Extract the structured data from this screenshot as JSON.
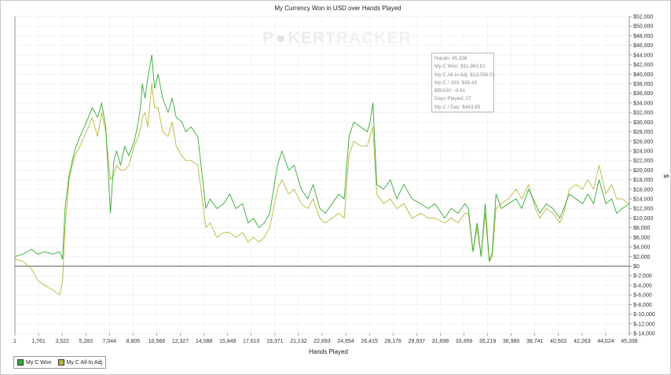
{
  "chart_data": {
    "type": "line",
    "title": "My Currency Won in USD over Hands Played",
    "xlabel": "Hands Played",
    "ylabel": "$",
    "watermark": {
      "part1": "P",
      "part2": "KER",
      "part3": "TRACKER"
    },
    "x_ticks": [
      "1",
      "1,761",
      "3,522",
      "5,283",
      "7,044",
      "8,805",
      "10,566",
      "12,327",
      "14,088",
      "15,849",
      "17,610",
      "19,371",
      "21,132",
      "22,893",
      "24,654",
      "26,415",
      "28,176",
      "29,937",
      "31,698",
      "33,459",
      "35,219",
      "36,980",
      "38,741",
      "40,502",
      "42,263",
      "44,024",
      "45,336"
    ],
    "xlim": [
      1,
      45336
    ],
    "ylim": [
      -14000,
      52000
    ],
    "y_ticks": [
      "$-14,000",
      "$-12,000",
      "$-10,000",
      "$-8,000",
      "$-6,000",
      "$-4,000",
      "$-2,000",
      "$0",
      "$2,000",
      "$4,000",
      "$6,000",
      "$8,000",
      "$10,000",
      "$12,000",
      "$14,000",
      "$16,000",
      "$18,000",
      "$20,000",
      "$22,000",
      "$24,000",
      "$26,000",
      "$28,000",
      "$30,000",
      "$32,000",
      "$34,000",
      "$36,000",
      "$38,000",
      "$40,000",
      "$42,000",
      "$44,000",
      "$46,000",
      "$48,000",
      "$50,000",
      "$52,000"
    ],
    "y_tick_values": [
      -14000,
      -12000,
      -10000,
      -8000,
      -6000,
      -4000,
      -2000,
      0,
      2000,
      4000,
      6000,
      8000,
      10000,
      12000,
      14000,
      16000,
      18000,
      20000,
      22000,
      24000,
      26000,
      28000,
      30000,
      32000,
      34000,
      36000,
      38000,
      40000,
      42000,
      44000,
      46000,
      48000,
      50000,
      52000
    ],
    "grid": true,
    "legend_position": "bottom-left",
    "series": [
      {
        "name": "My C Won",
        "color": "#33aa33",
        "x": [
          1,
          600,
          1200,
          1700,
          2200,
          2800,
          3300,
          3522,
          3700,
          4000,
          4400,
          4800,
          5283,
          5700,
          6100,
          6400,
          6700,
          7044,
          7300,
          7500,
          7800,
          8100,
          8400,
          8805,
          9100,
          9300,
          9400,
          9600,
          9800,
          10100,
          10300,
          10566,
          10900,
          11300,
          11600,
          11900,
          12327,
          12600,
          13000,
          13500,
          14088,
          14400,
          14900,
          15400,
          15849,
          16300,
          16800,
          17200,
          17610,
          18000,
          18400,
          18800,
          19371,
          19700,
          20200,
          20600,
          21132,
          21600,
          22000,
          22500,
          22893,
          23400,
          23900,
          24300,
          24654,
          25000,
          25500,
          26000,
          26200,
          26415,
          26700,
          27200,
          27700,
          28176,
          28700,
          29300,
          29937,
          30500,
          31000,
          31698,
          32200,
          32700,
          33200,
          33459,
          33800,
          34100,
          34400,
          34700,
          35000,
          35219,
          35500,
          35900,
          36400,
          36980,
          37400,
          37900,
          38400,
          38741,
          39200,
          39700,
          40200,
          40502,
          40900,
          41400,
          41900,
          42263,
          42700,
          43100,
          43600,
          44024,
          44400,
          44800,
          45336
        ],
        "y": [
          2000,
          2500,
          3500,
          2500,
          3000,
          2500,
          3000,
          1500,
          12000,
          19000,
          24000,
          27000,
          30000,
          33000,
          31000,
          34000,
          29000,
          11000,
          22000,
          24000,
          21000,
          25000,
          23000,
          26000,
          30000,
          34000,
          38000,
          35000,
          39000,
          44000,
          37000,
          40000,
          35000,
          32000,
          35000,
          31000,
          30000,
          28000,
          29000,
          27000,
          12000,
          14000,
          12000,
          13000,
          15000,
          12000,
          13000,
          9000,
          10000,
          8000,
          9000,
          11000,
          21000,
          24000,
          20000,
          21000,
          16000,
          14000,
          17000,
          12000,
          11000,
          13000,
          15000,
          14000,
          27000,
          30000,
          29000,
          28000,
          30000,
          34000,
          17000,
          16000,
          18000,
          14000,
          17000,
          14000,
          13000,
          12000,
          13000,
          10000,
          12000,
          11000,
          13000,
          12000,
          3000,
          9000,
          2000,
          13000,
          1000,
          3000,
          15000,
          12000,
          13000,
          14000,
          12000,
          16000,
          13000,
          11000,
          13000,
          12000,
          10000,
          12000,
          15000,
          14000,
          13000,
          15000,
          13000,
          18000,
          13000,
          14000,
          11000,
          12000,
          13000
        ]
      },
      {
        "name": "My C All-In Adj",
        "color": "#b8b83a",
        "x": [
          1,
          600,
          1200,
          1700,
          2200,
          2800,
          3300,
          3522,
          3700,
          4000,
          4400,
          4800,
          5283,
          5700,
          6100,
          6400,
          6700,
          7044,
          7300,
          7500,
          7800,
          8100,
          8400,
          8805,
          9100,
          9300,
          9400,
          9600,
          9800,
          10100,
          10300,
          10566,
          10900,
          11300,
          11600,
          11900,
          12327,
          12600,
          13000,
          13500,
          14088,
          14400,
          14900,
          15400,
          15849,
          16300,
          16800,
          17200,
          17610,
          18000,
          18400,
          18800,
          19371,
          19700,
          20200,
          20600,
          21132,
          21600,
          22000,
          22500,
          22893,
          23400,
          23900,
          24300,
          24654,
          25000,
          25500,
          26000,
          26200,
          26415,
          26700,
          27200,
          27700,
          28176,
          28700,
          29300,
          29937,
          30500,
          31000,
          31698,
          32200,
          32700,
          33200,
          33459,
          33800,
          34100,
          34400,
          34700,
          35000,
          35219,
          35500,
          35900,
          36400,
          36980,
          37400,
          37900,
          38400,
          38741,
          39200,
          39700,
          40200,
          40502,
          40900,
          41400,
          41900,
          42263,
          42700,
          43100,
          43600,
          44024,
          44400,
          44800,
          45336
        ],
        "y": [
          1500,
          1000,
          -500,
          -3000,
          -4000,
          -5000,
          -6000,
          -3000,
          8000,
          18000,
          23000,
          25000,
          28000,
          31000,
          27000,
          32000,
          28000,
          18000,
          19000,
          21000,
          20000,
          20000,
          21000,
          25000,
          27000,
          29000,
          31000,
          32000,
          29000,
          38000,
          33000,
          33000,
          28000,
          27000,
          30000,
          25000,
          23000,
          22000,
          22000,
          21000,
          8000,
          9000,
          6000,
          7000,
          7000,
          6000,
          7000,
          5000,
          6000,
          5000,
          6000,
          8000,
          16000,
          18000,
          15000,
          16000,
          13000,
          12000,
          14000,
          10000,
          9000,
          10000,
          11000,
          10000,
          23000,
          26000,
          25000,
          25000,
          27000,
          29000,
          15000,
          13000,
          14000,
          12000,
          13000,
          10000,
          11000,
          10000,
          10000,
          9000,
          10000,
          9000,
          11000,
          11000,
          3000,
          8000,
          2000,
          11000,
          1000,
          2000,
          12000,
          13000,
          14000,
          16000,
          14000,
          17000,
          12000,
          10000,
          12000,
          11000,
          9000,
          11000,
          16000,
          17000,
          16000,
          18000,
          16000,
          21000,
          15000,
          17000,
          14000,
          14000,
          13000
        ]
      }
    ]
  },
  "tooltip": {
    "lines": [
      "Hands: 45,336",
      "My C Won: $11,983.81",
      "My C All-In Adj: $13,056.01",
      "My C / 100: $26.43",
      "BB/100: -0.41",
      "Days Played: 27",
      "My C / Day: $443.85"
    ]
  },
  "legend": {
    "items": [
      {
        "label": "My C Won",
        "color": "#33aa33"
      },
      {
        "label": "My C All-In Adj",
        "color": "#b8b83a"
      }
    ]
  }
}
